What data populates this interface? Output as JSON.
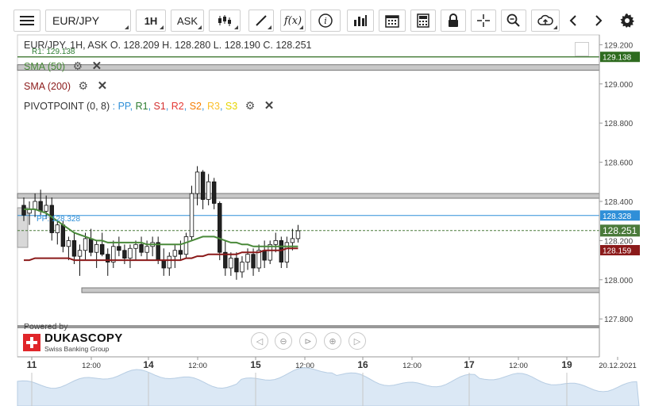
{
  "toolbar": {
    "symbol": "EUR/JPY",
    "timeframe": "1H",
    "side": "ASK",
    "icons": [
      "menu-icon",
      "candles-icon",
      "draw-line-icon",
      "fx-icon",
      "info-icon",
      "bars-icon",
      "calendar-icon",
      "calculator-icon",
      "lock-icon",
      "crosshair-icon",
      "zoom-icon",
      "upload-icon",
      "arrow-left-icon",
      "arrow-right-icon",
      "gear-icon"
    ]
  },
  "legend": {
    "ohlc": "EUR/JPY, 1H, ASK   O. 128.209 H. 128.280 L. 128.190 C. 128.251",
    "r1_tag": "R1: 129.138",
    "sma50": "SMA (50)",
    "sma200": "SMA (200)",
    "pivot_name": "PIVOTPOINT (0, 8)",
    "pivot_sep": ": ",
    "pivot_items": [
      {
        "label": "PP",
        "color": "#2f8fd8"
      },
      {
        "label": "R1",
        "color": "#2e7d32"
      },
      {
        "label": "S1",
        "color": "#d32f2f"
      },
      {
        "label": "R2",
        "color": "#e53935"
      },
      {
        "label": "S2",
        "color": "#f57c00"
      },
      {
        "label": "R3",
        "color": "#fbc02d"
      },
      {
        "label": "S3",
        "color": "#f5e500"
      }
    ],
    "pp_tag": "PP: 128.328"
  },
  "branding": {
    "powered": "Powered by",
    "name": "DUKASCOPY",
    "sub": "Swiss Banking Group"
  },
  "chart_data": {
    "type": "candlestick",
    "symbol": "EUR/JPY",
    "interval": "1H",
    "y_ticks": [
      "129.200",
      "129.000",
      "128.800",
      "128.600",
      "128.400",
      "128.200",
      "128.000",
      "127.800"
    ],
    "ylim": [
      127.74,
      129.23
    ],
    "x_labels": [
      "11",
      "12:00",
      "14",
      "12:00",
      "15",
      "12:00",
      "16",
      "12:00",
      "17",
      "12:00",
      "19",
      "20.12.2021"
    ],
    "price_tags": {
      "r1": {
        "label": "129.138",
        "value": 129.138,
        "color": "#2e6b1f"
      },
      "pp": {
        "label": "128.328",
        "value": 128.328,
        "color": "#2f8fd8"
      },
      "last": {
        "label": "128.251",
        "value": 128.251,
        "color": "#4a7a3a"
      },
      "sma200_tag": {
        "label": "128.159",
        "value": 128.159,
        "color": "#8b1a1a"
      },
      "hidden_tick": {
        "label": "128.200",
        "value": 128.2
      }
    },
    "levels": {
      "r1": 129.138,
      "pp": 128.328,
      "s1": 128.0
    },
    "bands": [
      {
        "name": "upper",
        "from": 129.09,
        "to": 129.11
      },
      {
        "name": "mid",
        "from": 128.435,
        "to": 128.46
      },
      {
        "name": "lower",
        "from": 127.99,
        "to": 128.01
      }
    ],
    "ohlc": [
      [
        128.38,
        128.42,
        128.3,
        128.33
      ],
      [
        128.34,
        128.4,
        128.28,
        128.36
      ],
      [
        128.36,
        128.44,
        128.32,
        128.4
      ],
      [
        128.4,
        128.46,
        128.33,
        128.35
      ],
      [
        128.35,
        128.43,
        128.31,
        128.38
      ],
      [
        128.38,
        128.42,
        128.2,
        128.24
      ],
      [
        128.24,
        128.3,
        128.18,
        128.28
      ],
      [
        128.28,
        128.3,
        128.14,
        128.17
      ],
      [
        128.17,
        128.22,
        128.1,
        128.2
      ],
      [
        128.2,
        128.24,
        128.08,
        128.12
      ],
      [
        128.12,
        128.18,
        128.02,
        128.15
      ],
      [
        128.15,
        128.24,
        128.1,
        128.21
      ],
      [
        128.21,
        128.26,
        128.12,
        128.14
      ],
      [
        128.14,
        128.2,
        128.06,
        128.18
      ],
      [
        128.18,
        128.24,
        128.12,
        128.13
      ],
      [
        128.13,
        128.16,
        128.02,
        128.09
      ],
      [
        128.09,
        128.2,
        128.06,
        128.17
      ],
      [
        128.17,
        128.22,
        128.12,
        128.15
      ],
      [
        128.15,
        128.18,
        128.08,
        128.11
      ],
      [
        128.11,
        128.18,
        128.06,
        128.16
      ],
      [
        128.16,
        128.2,
        128.1,
        128.18
      ],
      [
        128.18,
        128.22,
        128.12,
        128.14
      ],
      [
        128.14,
        128.2,
        128.1,
        128.17
      ],
      [
        128.17,
        128.22,
        128.12,
        128.19
      ],
      [
        128.19,
        128.22,
        128.08,
        128.1
      ],
      [
        128.1,
        128.16,
        128.02,
        128.06
      ],
      [
        128.06,
        128.14,
        128.02,
        128.12
      ],
      [
        128.12,
        128.18,
        128.06,
        128.15
      ],
      [
        128.15,
        128.2,
        128.1,
        128.13
      ],
      [
        128.13,
        128.24,
        128.11,
        128.22
      ],
      [
        128.22,
        128.48,
        128.2,
        128.44
      ],
      [
        128.44,
        128.58,
        128.38,
        128.55
      ],
      [
        128.55,
        128.56,
        128.36,
        128.41
      ],
      [
        128.41,
        128.54,
        128.38,
        128.5
      ],
      [
        128.5,
        128.52,
        128.36,
        128.39
      ],
      [
        128.39,
        128.4,
        128.1,
        128.14
      ],
      [
        128.14,
        128.2,
        128.02,
        128.06
      ],
      [
        128.06,
        128.14,
        128.02,
        128.11
      ],
      [
        128.11,
        128.14,
        128.0,
        128.04
      ],
      [
        128.04,
        128.12,
        128.01,
        128.09
      ],
      [
        128.09,
        128.16,
        128.05,
        128.13
      ],
      [
        128.13,
        128.16,
        128.02,
        128.06
      ],
      [
        128.06,
        128.18,
        128.04,
        128.15
      ],
      [
        128.15,
        128.2,
        128.06,
        128.1
      ],
      [
        128.1,
        128.2,
        128.08,
        128.18
      ],
      [
        128.18,
        128.24,
        128.14,
        128.2
      ],
      [
        128.2,
        128.22,
        128.06,
        128.09
      ],
      [
        128.09,
        128.22,
        128.06,
        128.19
      ],
      [
        128.19,
        128.26,
        128.15,
        128.21
      ],
      [
        128.21,
        128.28,
        128.19,
        128.25
      ]
    ],
    "sma50": [
      128.36,
      128.36,
      128.36,
      128.35,
      128.34,
      128.32,
      128.3,
      128.28,
      128.26,
      128.24,
      128.23,
      128.22,
      128.21,
      128.2,
      128.2,
      128.19,
      128.19,
      128.19,
      128.19,
      128.19,
      128.19,
      128.19,
      128.18,
      128.18,
      128.18,
      128.18,
      128.18,
      128.18,
      128.18,
      128.19,
      128.2,
      128.21,
      128.22,
      128.22,
      128.22,
      128.21,
      128.2,
      128.19,
      128.19,
      128.18,
      128.18,
      128.17,
      128.17,
      128.17,
      128.17,
      128.17,
      128.17,
      128.17,
      128.17,
      128.17
    ],
    "sma200": [
      128.1,
      128.1,
      128.11,
      128.11,
      128.11,
      128.11,
      128.11,
      128.11,
      128.11,
      128.1,
      128.1,
      128.1,
      128.1,
      128.1,
      128.1,
      128.1,
      128.1,
      128.1,
      128.1,
      128.1,
      128.1,
      128.1,
      128.1,
      128.1,
      128.1,
      128.1,
      128.1,
      128.1,
      128.1,
      128.11,
      128.11,
      128.12,
      128.12,
      128.13,
      128.13,
      128.13,
      128.13,
      128.13,
      128.13,
      128.14,
      128.14,
      128.14,
      128.14,
      128.15,
      128.15,
      128.15,
      128.15,
      128.16,
      128.16,
      128.16
    ]
  }
}
